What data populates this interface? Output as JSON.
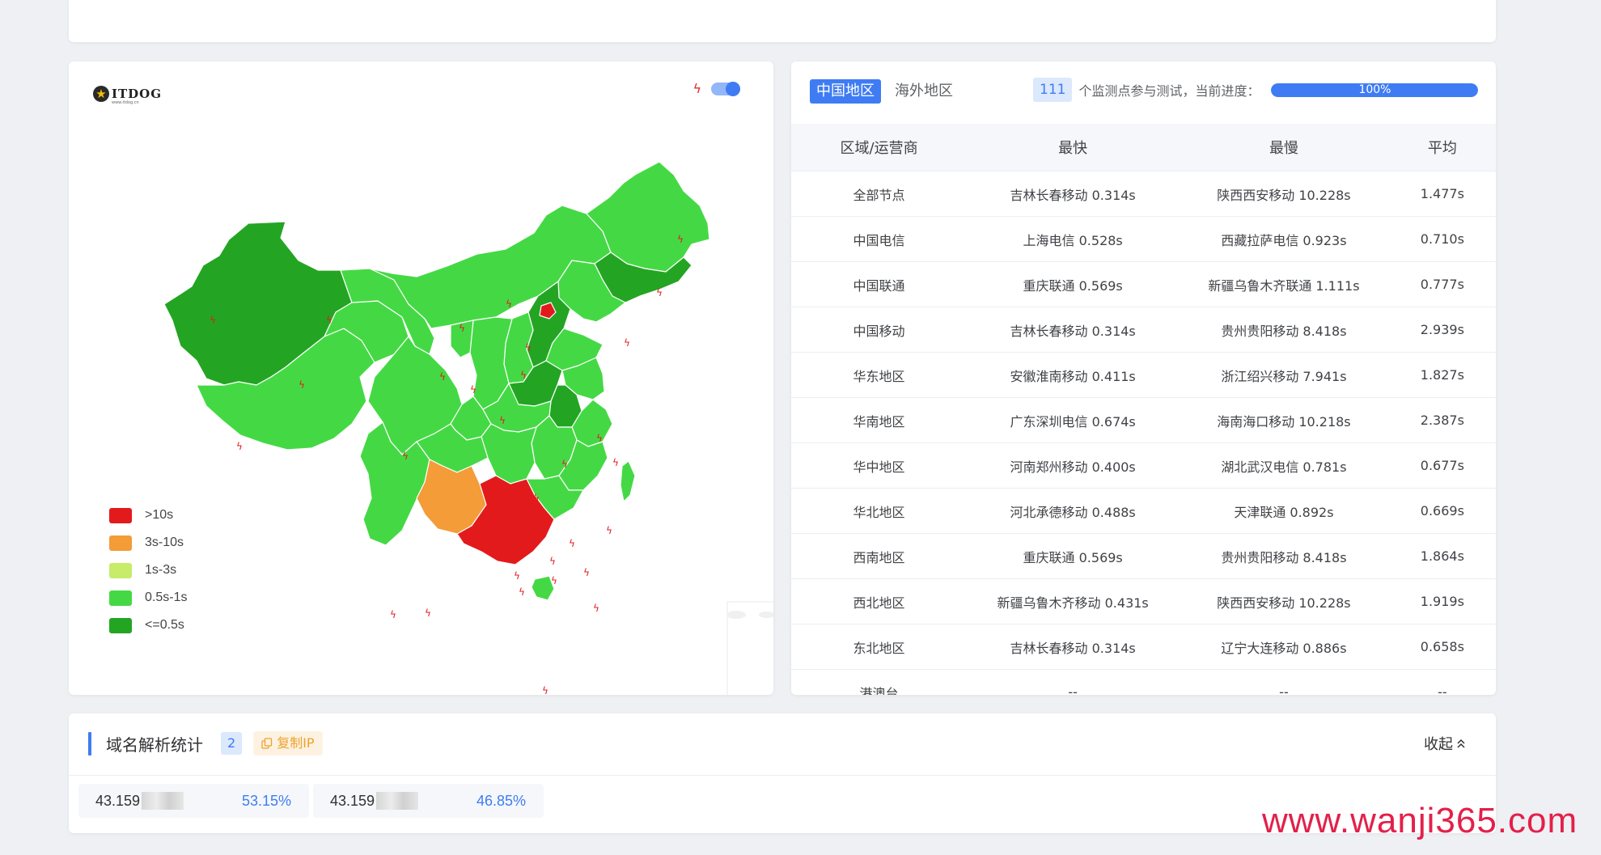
{
  "map": {
    "logo_text": "ITDOG",
    "logo_sub": "www.itdog.cn",
    "legend": [
      {
        "label": ">10s",
        "color": "#e31a1c"
      },
      {
        "label": "3s-10s",
        "color": "#f39c38"
      },
      {
        "label": "1s-3s",
        "color": "#c6ec6a"
      },
      {
        "label": "0.5s-1s",
        "color": "#44d944"
      },
      {
        "label": "<=0.5s",
        "color": "#23a523"
      }
    ]
  },
  "results": {
    "tabs": [
      {
        "label": "中国地区",
        "active": true
      },
      {
        "label": "海外地区",
        "active": false
      }
    ],
    "node_count": "111",
    "progress_text": "个监测点参与测试，当前进度：",
    "progress_value": 1.0,
    "progress_label": "100%",
    "headers": [
      "区域/运营商",
      "最快",
      "最慢",
      "平均"
    ],
    "rows": [
      [
        "全部节点",
        "吉林长春移动 0.314s",
        "陕西西安移动 10.228s",
        "1.477s"
      ],
      [
        "中国电信",
        "上海电信 0.528s",
        "西藏拉萨电信 0.923s",
        "0.710s"
      ],
      [
        "中国联通",
        "重庆联通 0.569s",
        "新疆乌鲁木齐联通 1.111s",
        "0.777s"
      ],
      [
        "中国移动",
        "吉林长春移动 0.314s",
        "贵州贵阳移动 8.418s",
        "2.939s"
      ],
      [
        "华东地区",
        "安徽淮南移动 0.411s",
        "浙江绍兴移动 7.941s",
        "1.827s"
      ],
      [
        "华南地区",
        "广东深圳电信 0.674s",
        "海南海口移动 10.218s",
        "2.387s"
      ],
      [
        "华中地区",
        "河南郑州移动 0.400s",
        "湖北武汉电信 0.781s",
        "0.677s"
      ],
      [
        "华北地区",
        "河北承德移动 0.488s",
        "天津联通 0.892s",
        "0.669s"
      ],
      [
        "西南地区",
        "重庆联通 0.569s",
        "贵州贵阳移动 8.418s",
        "1.864s"
      ],
      [
        "西北地区",
        "新疆乌鲁木齐移动 0.431s",
        "陕西西安移动 10.228s",
        "1.919s"
      ],
      [
        "东北地区",
        "吉林长春移动 0.314s",
        "辽宁大连移动 0.886s",
        "0.658s"
      ],
      [
        "港澳台",
        "--",
        "--",
        "--"
      ]
    ]
  },
  "dns": {
    "title": "域名解析统计",
    "count": "2",
    "copy_label": "复制IP",
    "collapse_label": "收起",
    "ips": [
      {
        "ip": "43.159",
        "pct": "53.15%"
      },
      {
        "ip": "43.159",
        "pct": "46.85%"
      }
    ]
  },
  "watermark": "www.wanji365.com"
}
